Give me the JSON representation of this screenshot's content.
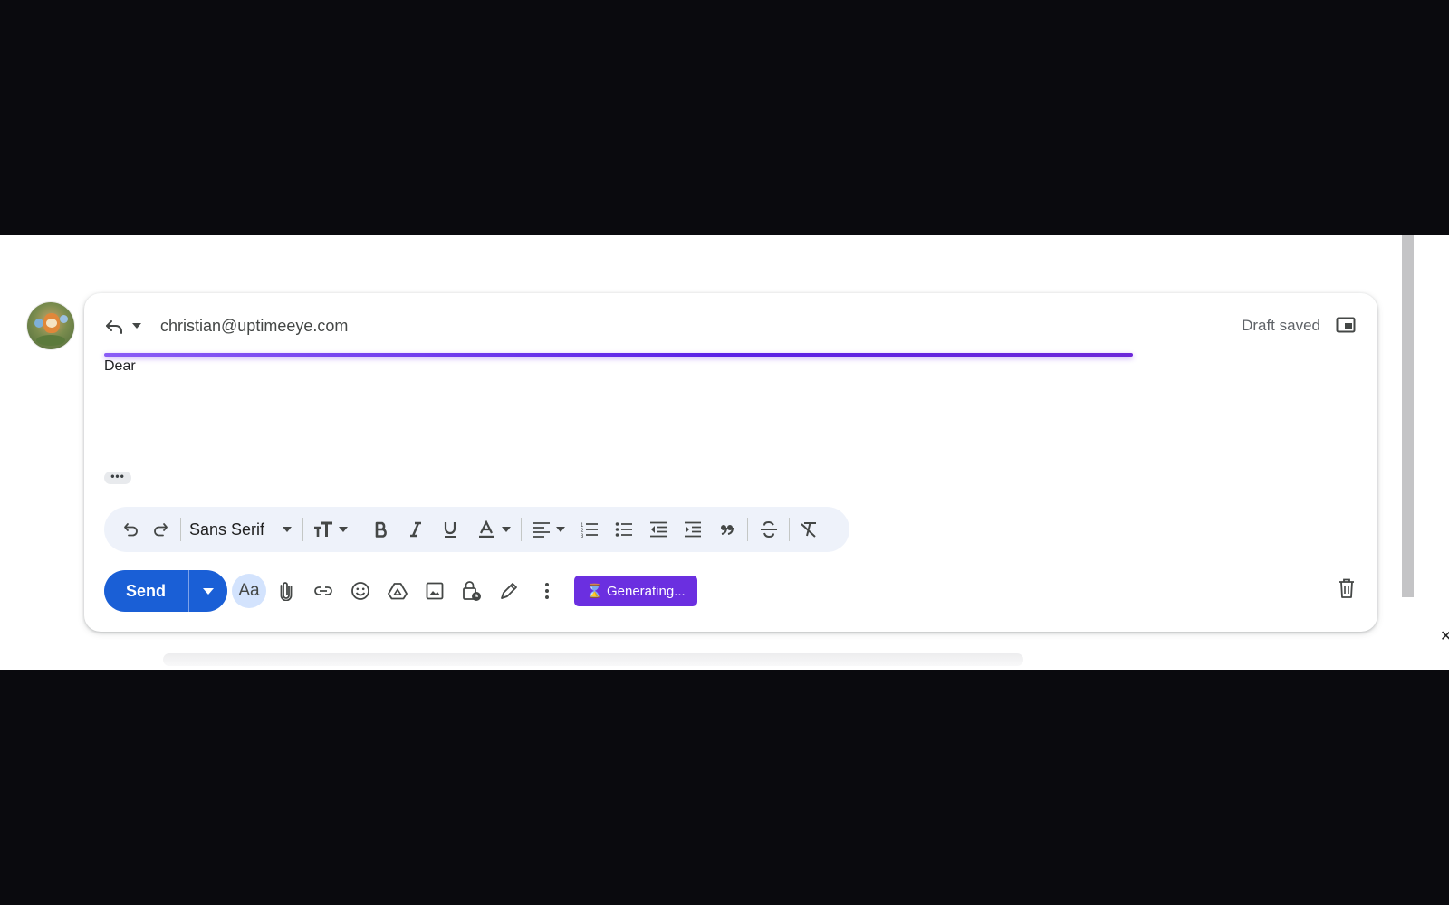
{
  "compose": {
    "recipient": "christian@uptimeeye.com",
    "status": "Draft saved",
    "body_text": "Dear",
    "trimmed_content": "•••"
  },
  "formatting": {
    "font_family": "Sans Serif"
  },
  "actions": {
    "send_label": "Send",
    "aa_label": "Aa",
    "generating_label": "Generating...",
    "generating_icon": "⌛"
  },
  "colors": {
    "send_button": "#1a5fd6",
    "generating_badge": "#6b2fe0",
    "progress_bar": "#5b21e6"
  },
  "icons": [
    "reply-icon",
    "dropdown-caret-icon",
    "popout-icon",
    "undo-icon",
    "redo-icon",
    "text-size-icon",
    "bold-icon",
    "italic-icon",
    "underline-icon",
    "text-color-icon",
    "align-icon",
    "numbered-list-icon",
    "bulleted-list-icon",
    "indent-less-icon",
    "indent-more-icon",
    "quote-icon",
    "strikethrough-icon",
    "remove-formatting-icon",
    "attach-icon",
    "link-icon",
    "emoji-icon",
    "drive-icon",
    "photo-icon",
    "confidential-mode-icon",
    "signature-icon",
    "more-options-icon",
    "trash-icon",
    "close-icon"
  ]
}
